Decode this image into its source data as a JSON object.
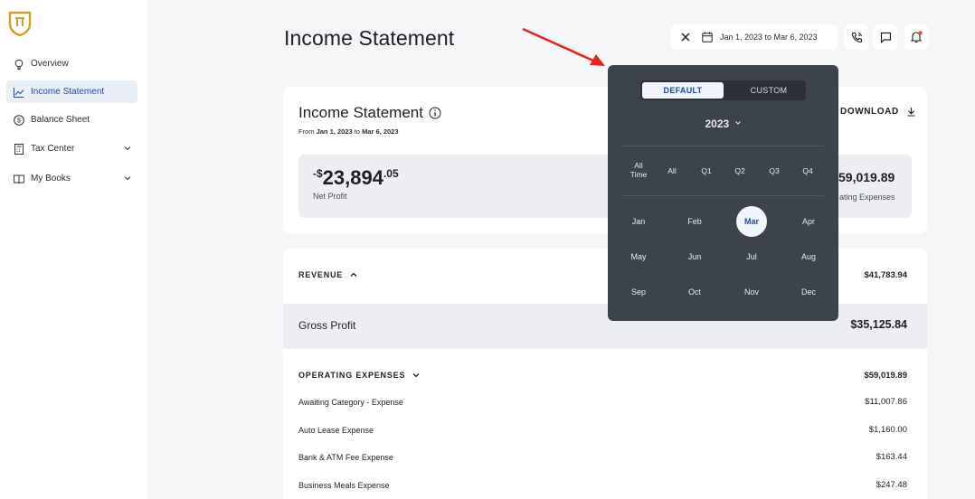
{
  "sidebar": {
    "items": [
      {
        "label": "Overview"
      },
      {
        "label": "Income Statement"
      },
      {
        "label": "Balance Sheet"
      },
      {
        "label": "Tax Center"
      },
      {
        "label": "My Books"
      }
    ]
  },
  "header": {
    "title": "Income Statement",
    "date_range": "Jan 1, 2023 to Mar 6, 2023"
  },
  "summary": {
    "title": "Income Statement",
    "from_prefix": "From ",
    "from_date": "Jan 1, 2023",
    "to_word": " to ",
    "to_date": "Mar 6, 2023",
    "download_label": "DOWNLOAD",
    "net_profit_sign": "-$",
    "net_profit_whole": "23,894",
    "net_profit_cents": ".05",
    "net_profit_label": "Net Profit",
    "opex_value": "59,019.89",
    "opex_label": "ating Expenses"
  },
  "report": {
    "revenue_label": "REVENUE",
    "revenue_value": "$41,783.94",
    "gross_profit_label": "Gross Profit",
    "gross_profit_value": "$35,125.84",
    "opex_label": "OPERATING EXPENSES",
    "opex_value": "$59,019.89",
    "rows": [
      {
        "label": "Awaiting Category - Expense",
        "value": "$11,007.86"
      },
      {
        "label": "Auto Lease Expense",
        "value": "$1,160.00"
      },
      {
        "label": "Bank & ATM Fee Expense",
        "value": "$163.44"
      },
      {
        "label": "Business Meals Expense",
        "value": "$247.48"
      }
    ]
  },
  "picker": {
    "default_label": "DEFAULT",
    "custom_label": "CUSTOM",
    "year": "2023",
    "quarters": [
      "All\nTime",
      "All",
      "Q1",
      "Q2",
      "Q3",
      "Q4"
    ],
    "months": [
      "Jan",
      "Feb",
      "Mar",
      "Apr",
      "May",
      "Jun",
      "Jul",
      "Aug",
      "Sep",
      "Oct",
      "Nov",
      "Dec"
    ],
    "selected_month": "Mar"
  },
  "colors": {
    "accent": "#1f4aa3",
    "logo": "#c9a227",
    "popover_bg": "#3d434d",
    "annotation_arrow": "#e8231f",
    "notification_dot": "#e5483b"
  }
}
